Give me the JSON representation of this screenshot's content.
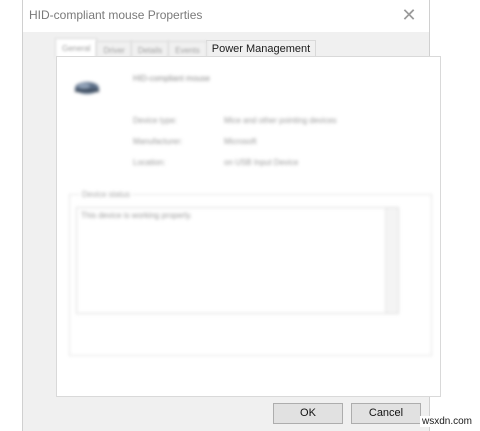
{
  "window": {
    "title": "HID-compliant mouse Properties",
    "close_glyph": "✕"
  },
  "tabs": [
    {
      "label": "General",
      "active": true,
      "legible": false
    },
    {
      "label": "Driver",
      "active": false,
      "legible": false
    },
    {
      "label": "Details",
      "active": false,
      "legible": false
    },
    {
      "label": "Events",
      "active": false,
      "legible": false
    },
    {
      "label": "Power Management",
      "active": false,
      "legible": true
    }
  ],
  "general": {
    "device_icon": "mouse-icon",
    "device_name": "HID-compliant mouse",
    "properties": [
      {
        "label": "Device type:",
        "value": "Mice and other pointing devices"
      },
      {
        "label": "Manufacturer:",
        "value": "Microsoft"
      },
      {
        "label": "Location:",
        "value": "on USB Input Device"
      }
    ],
    "status_legend": "Device status",
    "status_text": "This device is working properly."
  },
  "buttons": {
    "ok": "OK",
    "cancel": "Cancel"
  },
  "watermark": "wsxdn.com"
}
